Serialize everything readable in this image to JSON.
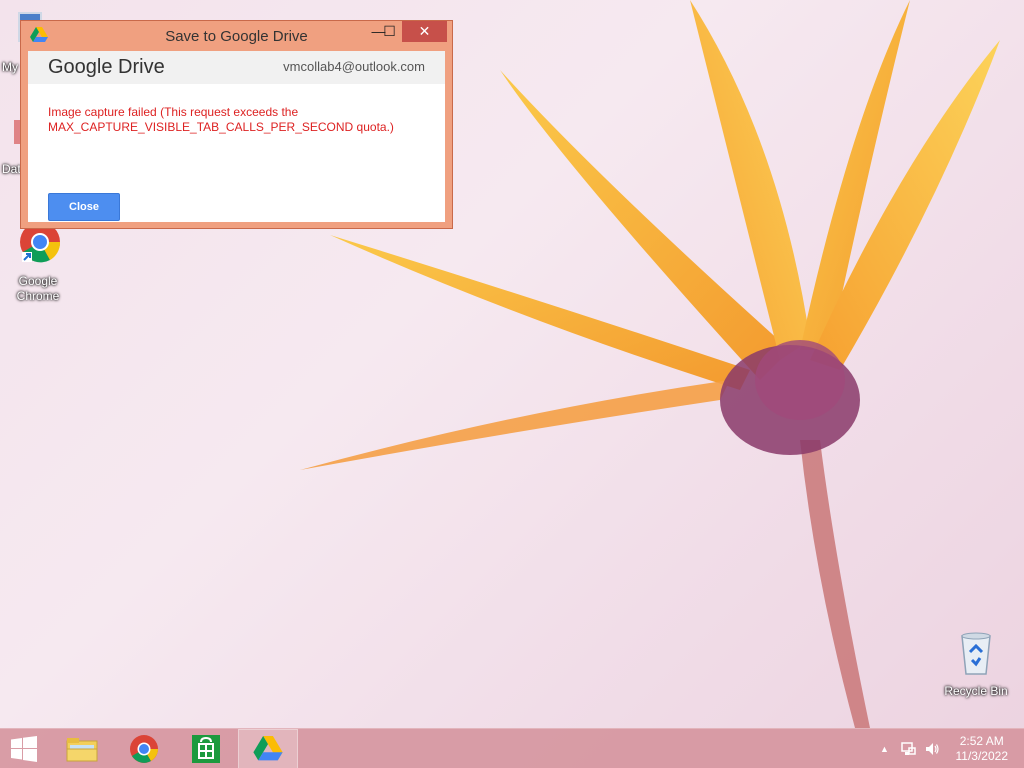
{
  "desktop": {
    "partial_icons": [
      {
        "label": "My"
      },
      {
        "label": "Dat"
      }
    ],
    "chrome_icon": {
      "label_line1": "Google",
      "label_line2": "Chrome"
    },
    "recycle_bin": {
      "label": "Recycle Bin"
    }
  },
  "dialog": {
    "title": "Save to Google Drive",
    "minimize_glyph": "—",
    "maximize_glyph": "☐",
    "close_glyph": "✕",
    "header": {
      "app_name": "Google Drive",
      "account": "vmcollab4@outlook.com"
    },
    "error_line1": "Image capture failed (This request exceeds the",
    "error_line2": "MAX_CAPTURE_VISIBLE_TAB_CALLS_PER_SECOND quota.)",
    "close_button_label": "Close",
    "colors": {
      "frame": "#f0a080",
      "error_text": "#dd2222",
      "button": "#4d8ef0",
      "close_button": "#c7504a"
    }
  },
  "taskbar": {
    "items": [
      {
        "name": "start",
        "icon": "windows-logo-icon"
      },
      {
        "name": "file-explorer",
        "icon": "folder-icon"
      },
      {
        "name": "chrome",
        "icon": "chrome-icon"
      },
      {
        "name": "store",
        "icon": "store-icon"
      },
      {
        "name": "google-drive",
        "icon": "google-drive-icon",
        "active": true
      }
    ],
    "tray": {
      "chevron": "▲",
      "time": "2:52 AM",
      "date": "11/3/2022"
    }
  }
}
